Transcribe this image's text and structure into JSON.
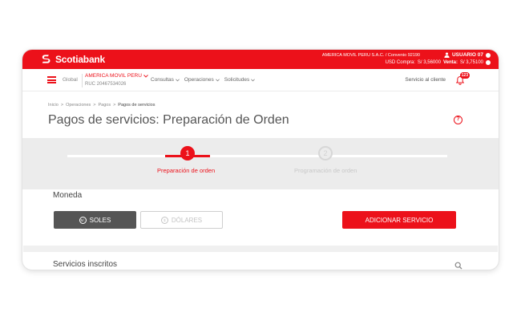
{
  "header": {
    "brand": "Scotiabank",
    "company_line": "AMERICA MOVIL PERU S.A.C. / Convenio 92190",
    "user": "USUARIO 07",
    "rates": {
      "compra_label": "USD Compra:",
      "compra_value": "S/ 3,56000",
      "venta_label": "Venta:",
      "venta_value": "S/ 3,75100"
    }
  },
  "nav": {
    "global": "Global",
    "company": "AMERICA MOVIL PERU",
    "ruc": "RUC 20467534026",
    "menu": [
      "Consultas",
      "Operaciones",
      "Solicitudes"
    ],
    "service": "Servicio al cliente",
    "notifications": "123"
  },
  "breadcrumb": [
    "Inicio",
    "Operaciones",
    "Pagos",
    "Pagos de servicios"
  ],
  "page": {
    "title": "Pagos de servicios: Preparación de Orden",
    "help": "?"
  },
  "stepper": {
    "steps": [
      {
        "number": "1",
        "label": "Preparación de orden",
        "active": true
      },
      {
        "number": "2",
        "label": "Programación de orden",
        "active": false
      }
    ]
  },
  "moneda": {
    "label": "Moneda",
    "soles": "SOLES",
    "soles_symbol": "S/.",
    "dolares": "DÓLARES",
    "dolares_symbol": "$",
    "add_service": "ADICIONAR SERVICIO"
  },
  "servicios": {
    "label": "Servicios inscritos"
  },
  "colors": {
    "brand_red": "#ec111a",
    "selected_button": "#555555",
    "stepper_bg": "#ececec"
  }
}
